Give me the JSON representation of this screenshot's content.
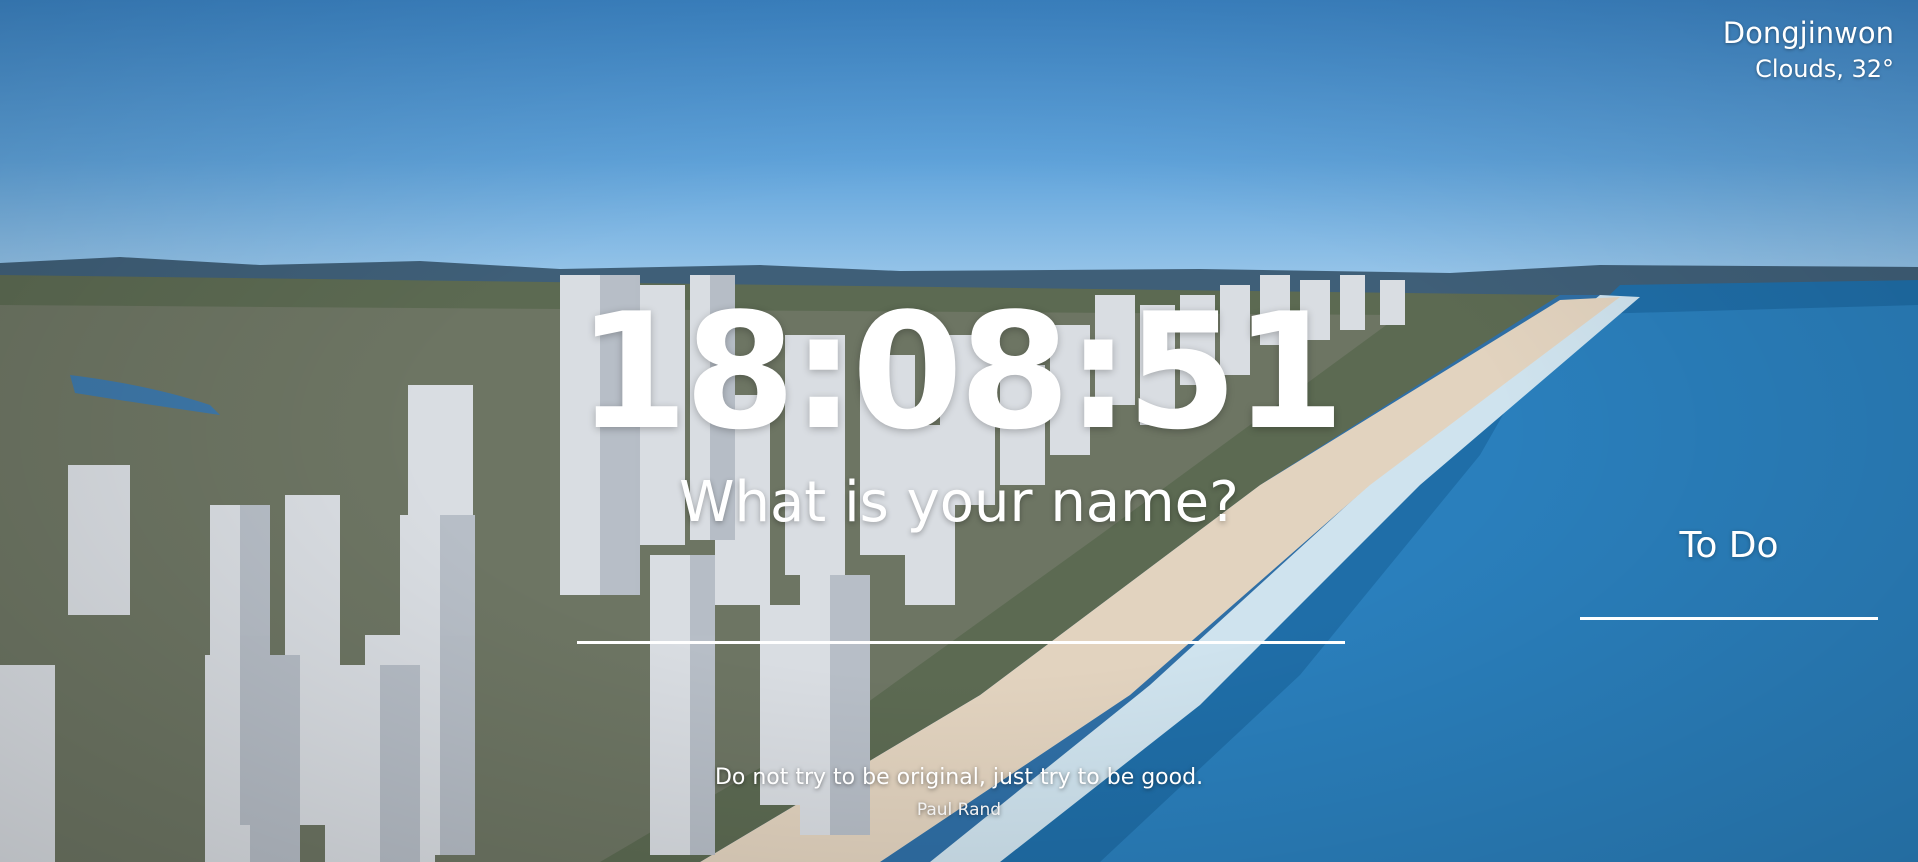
{
  "weather": {
    "location": "Dongjinwon",
    "condition": "Clouds, 32°"
  },
  "clock": {
    "time": "18:08:51"
  },
  "greeting": {
    "prompt": "What is your name?",
    "input_value": ""
  },
  "todo": {
    "title": "To Do",
    "input_value": ""
  },
  "quote": {
    "text": "Do not try to be original, just try to be good.",
    "author": "Paul Rand"
  }
}
